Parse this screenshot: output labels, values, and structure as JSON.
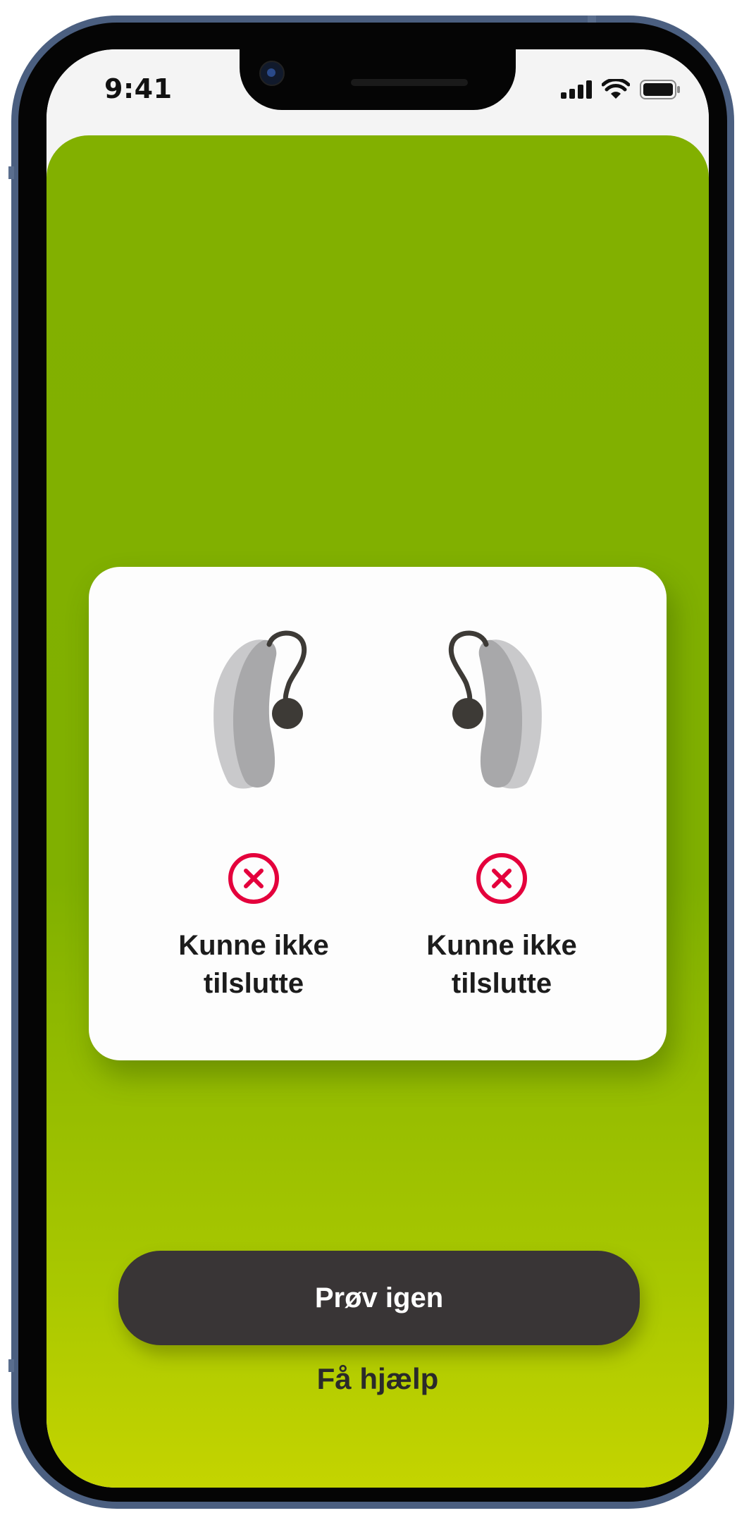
{
  "status_bar": {
    "time": "9:41",
    "signal_icon": "cellular-signal-icon",
    "wifi_icon": "wifi-icon",
    "battery_icon": "battery-icon"
  },
  "connection_card": {
    "left_device": {
      "icon": "hearing-aid-left-icon",
      "status_icon": "error-x-circle-icon",
      "status_text": "Kunne ikke\ntilslutte"
    },
    "right_device": {
      "icon": "hearing-aid-right-icon",
      "status_icon": "error-x-circle-icon",
      "status_text": "Kunne ikke\ntilslutte"
    }
  },
  "actions": {
    "retry_label": "Prøv igen",
    "help_label": "Få hjælp"
  },
  "colors": {
    "background_top": "#82b000",
    "background_bottom": "#c4d400",
    "button": "#393536",
    "error": "#e4003c"
  }
}
